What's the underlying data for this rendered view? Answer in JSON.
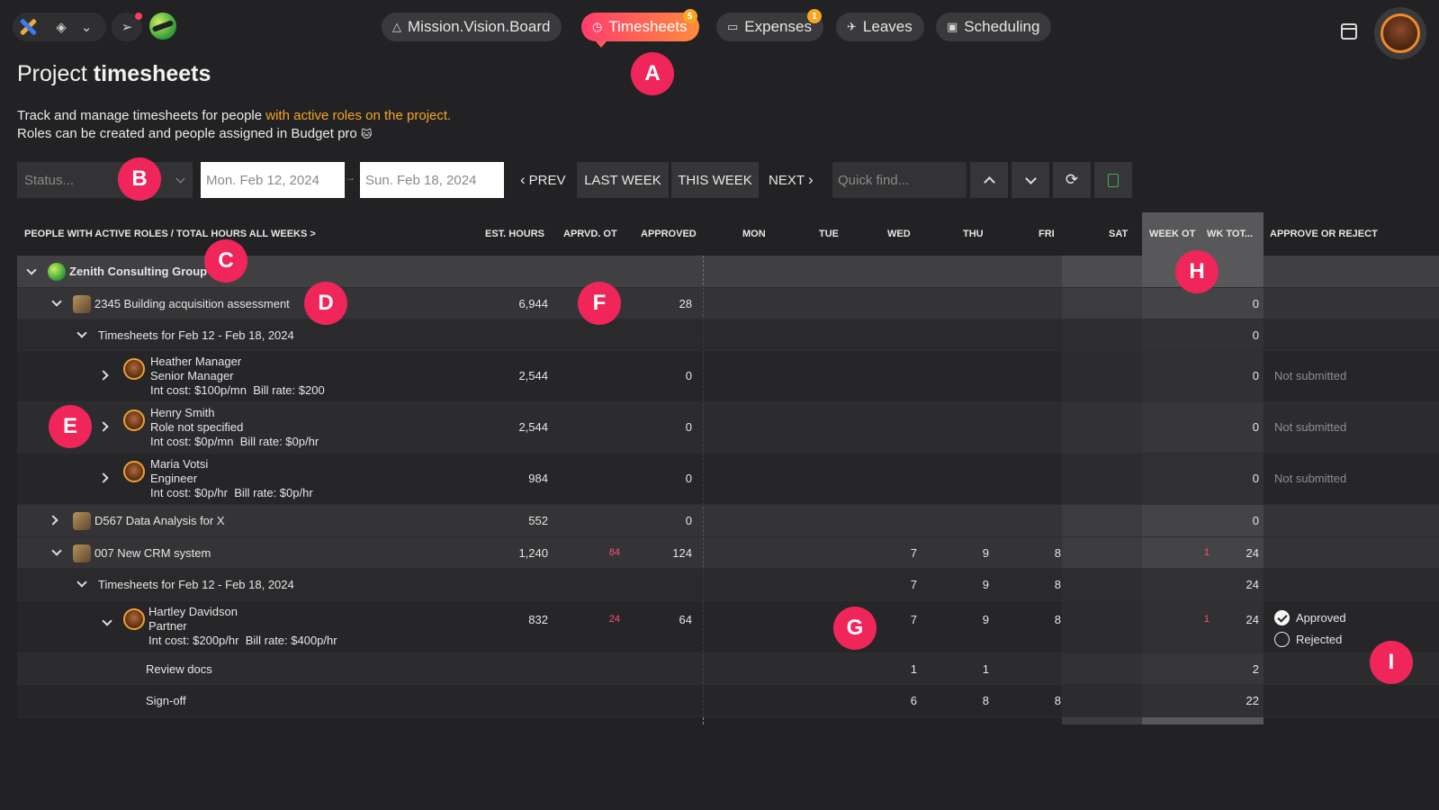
{
  "nav": {
    "tabs": [
      {
        "label": "Mission.Vision.Board",
        "icon": "triangle-icon",
        "badge": null
      },
      {
        "label": "Timesheets",
        "icon": "clock-icon",
        "badge": "5"
      },
      {
        "label": "Expenses",
        "icon": "card-icon",
        "badge": "1"
      },
      {
        "label": "Leaves",
        "icon": "plane-icon",
        "badge": null
      },
      {
        "label": "Scheduling",
        "icon": "calendar-icon",
        "badge": null
      }
    ]
  },
  "page": {
    "title_prefix": "Project",
    "title_bold": "timesheets",
    "desc_line1_a": "Track and manage timesheets for people ",
    "desc_line1_hl": "with active roles on the project.",
    "desc_line2": "Roles can be created and people assigned in Budget pro",
    "desc_emoji": "🐱"
  },
  "filters": {
    "status_placeholder": "Status...",
    "date_from": "Mon. Feb 12, 2024",
    "date_to": "Sun. Feb 18, 2024",
    "date_arrow": "→",
    "prev": "PREV",
    "last_week": "LAST WEEK",
    "this_week": "THIS WEEK",
    "next": "NEXT",
    "quick_find_placeholder": "Quick find..."
  },
  "markers": [
    "A",
    "B",
    "C",
    "D",
    "E",
    "F",
    "G",
    "H",
    "I"
  ],
  "table": {
    "headers": {
      "people": "PEOPLE WITH ACTIVE ROLES / TOTAL HOURS ALL WEEKS >",
      "est": "EST. HOURS",
      "apprvd_ot": "APRVD. OT",
      "approved": "APPROVED",
      "mon": "MON",
      "tue": "TUE",
      "wed": "WED",
      "thu": "THU",
      "fri": "FRI",
      "sat": "SAT",
      "week_ot": "WEEK OT",
      "wk_tot": "WK TOT...",
      "approve": "APPROVE OR REJECT"
    },
    "group": "Zenith Consulting Group",
    "projects": {
      "p1": {
        "name": "2345 Building acquisition assessment",
        "est": "6,944",
        "approved": "28",
        "wktot": "0"
      },
      "p1_week": {
        "label": "Timesheets for Feb 12 - Feb 18, 2024",
        "wktot": "0"
      },
      "p2": {
        "name": "D567 Data Analysis for X",
        "est": "552",
        "approved": "0",
        "wktot": "0"
      },
      "p3": {
        "name": "007 New CRM system",
        "est": "1,240",
        "ot": "84",
        "approved": "124",
        "wed": "7",
        "thu": "9",
        "fri": "8",
        "weekot": "1",
        "wktot": "24"
      },
      "p3_week": {
        "label": "Timesheets for Feb 12 - Feb 18, 2024",
        "wed": "7",
        "thu": "9",
        "fri": "8",
        "wktot": "24"
      }
    },
    "people": {
      "heather": {
        "name": "Heather Manager",
        "role": "Senior Manager",
        "int": "Int cost: $100p/mn",
        "bill": "Bill rate: $200",
        "est": "2,544",
        "approved": "0",
        "wktot": "0",
        "status": "Not submitted"
      },
      "henry": {
        "name": "Henry Smith",
        "role": "Role not specified",
        "int": "Int cost: $0p/mn",
        "bill": "Bill rate: $0p/hr",
        "est": "2,544",
        "approved": "0",
        "wktot": "0",
        "status": "Not submitted"
      },
      "maria": {
        "name": "Maria Votsi",
        "role": "Engineer",
        "int": "Int cost: $0p/hr",
        "bill": "Bill rate: $0p/hr",
        "est": "984",
        "approved": "0",
        "wktot": "0",
        "status": "Not submitted"
      },
      "hartley": {
        "name": "Hartley Davidson",
        "role": "Partner",
        "int": "Int cost: $200p/hr",
        "bill": "Bill rate: $400p/hr",
        "est": "832",
        "ot": "24",
        "approved": "64",
        "wed": "7",
        "thu": "9",
        "fri": "8",
        "weekot": "1",
        "wktot": "24",
        "opt_approved": "Approved",
        "opt_rejected": "Rejected"
      }
    },
    "tasks": {
      "review": {
        "name": "Review docs",
        "wed": "1",
        "thu": "1",
        "wktot": "2"
      },
      "signoff": {
        "name": "Sign-off",
        "wed": "6",
        "thu": "8",
        "fri": "8",
        "wktot": "22"
      }
    }
  }
}
